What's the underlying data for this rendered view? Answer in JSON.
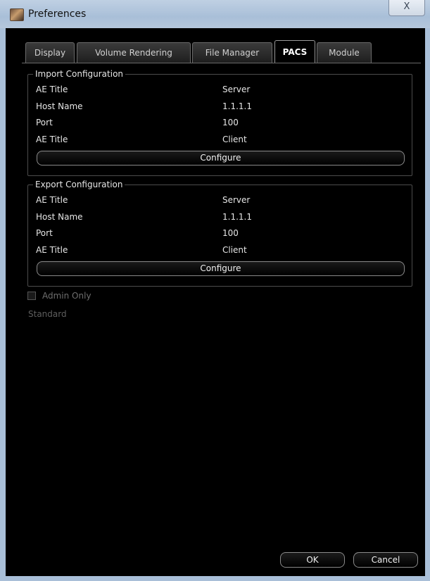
{
  "window": {
    "title": "Preferences",
    "close_glyph": "X"
  },
  "tabs": [
    {
      "label": "Display"
    },
    {
      "label": "Volume Rendering"
    },
    {
      "label": "File Manager"
    },
    {
      "label": "PACS",
      "active": true
    },
    {
      "label": "Module"
    }
  ],
  "import_config": {
    "legend": "Import Configuration",
    "rows": [
      {
        "label": "AE Title",
        "value": "Server"
      },
      {
        "label": "Host Name",
        "value": "1.1.1.1"
      },
      {
        "label": "Port",
        "value": "100"
      },
      {
        "label": "AE Title",
        "value": "Client"
      }
    ],
    "button": "Configure"
  },
  "export_config": {
    "legend": "Export Configuration",
    "rows": [
      {
        "label": "AE Title",
        "value": "Server"
      },
      {
        "label": "Host Name",
        "value": "1.1.1.1"
      },
      {
        "label": "Port",
        "value": "100"
      },
      {
        "label": "AE Title",
        "value": "Client"
      }
    ],
    "button": "Configure"
  },
  "admin_only": {
    "label": "Admin Only",
    "checked": false,
    "enabled": false
  },
  "mode_text": "Standard",
  "footer": {
    "ok": "OK",
    "cancel": "Cancel"
  },
  "colors": {
    "background": "#000000",
    "frame": "#a9bfd8",
    "text": "#e6e6e6",
    "disabled_text": "#6e6e6e"
  }
}
